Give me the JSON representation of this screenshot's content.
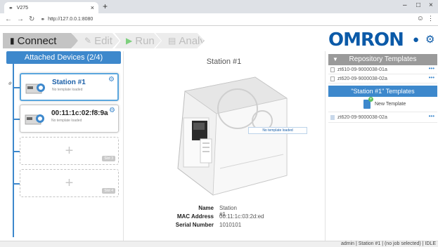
{
  "browser": {
    "tab_title": "V275",
    "tab_close": "×",
    "new_tab": "+",
    "url": "http://127.0.0.1:8080",
    "win_minimize": "–",
    "win_maximize": "□",
    "win_close": "×"
  },
  "toolbar": {
    "steps": [
      {
        "label": "Connect",
        "state": "active"
      },
      {
        "label": "Edit",
        "state": "disabled"
      },
      {
        "label": "Run",
        "state": "disabled"
      },
      {
        "label": "Analyze",
        "state": "disabled"
      }
    ],
    "logo": "OMRON"
  },
  "devices": {
    "header": "Attached Devices (2/4)",
    "slots": [
      {
        "name": "Station #1",
        "subtitle": "No template loaded",
        "selected": true
      },
      {
        "name": "00:11:1c:02:f8:9a",
        "subtitle": "No template loaded",
        "selected": false
      },
      {
        "label": "Slot 3",
        "plus": "+"
      },
      {
        "label": "Slot 4",
        "plus": "+"
      }
    ]
  },
  "station": {
    "title": "Station #1",
    "status_overlay": "No template loaded",
    "info": {
      "name_label": "Name",
      "name_value": "Station #1",
      "mac_label": "MAC Address",
      "mac_value": "00:11:1c:03:2d:ed",
      "serial_label": "Serial Number",
      "serial_value": "1010101"
    }
  },
  "repository": {
    "header": "Repository Templates",
    "items": [
      "zt610-09-9000038-01a",
      "zt620-09-9000038-02a"
    ],
    "more": "•••"
  },
  "station_templates": {
    "header": "\"Station #1\" Templates",
    "new_label": "New Template",
    "items": [
      "zt620-09-9000038-02a"
    ],
    "more": "•••"
  },
  "statusbar": {
    "text": "admin | Station #1 | (no job selected) | IDLE"
  },
  "colors": {
    "accent": "#3d88cc",
    "brand": "#0b5aa8"
  }
}
